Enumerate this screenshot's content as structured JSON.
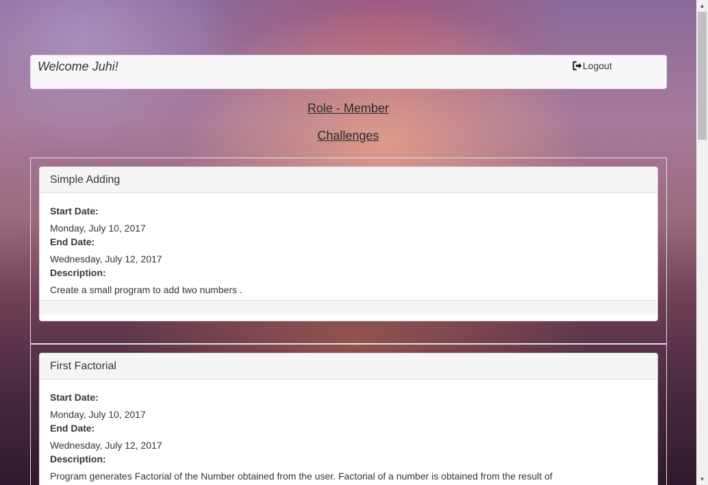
{
  "header": {
    "welcome": "Welcome Juhi!",
    "logout_label": "Logout"
  },
  "nav": {
    "role_link": "Role - Member",
    "challenges_link": "Challenges"
  },
  "challenges": [
    {
      "title": "Simple Adding",
      "start_label": "Start Date:",
      "start_date": "Monday, July 10, 2017",
      "end_label": "End Date:",
      "end_date": "Wednesday, July 12, 2017",
      "description_label": "Description:",
      "description": "Create a small program to add two numbers ."
    },
    {
      "title": "First Factorial",
      "start_label": "Start Date:",
      "start_date": "Monday, July 10, 2017",
      "end_label": "End Date:",
      "end_date": "Wednesday, July 12, 2017",
      "description_label": "Description:",
      "description": "Program generates Factorial of the Number obtained from the user. Factorial of a number is obtained from the result of"
    }
  ],
  "colors": {
    "panel_heading_bg": "#f5f5f5",
    "header_bg": "#f8f8f8",
    "text": "#333333"
  },
  "icons": {
    "logout": "log-out-icon",
    "scroll_up": "scroll-up-arrow-icon",
    "scroll_down": "scroll-down-arrow-icon"
  }
}
